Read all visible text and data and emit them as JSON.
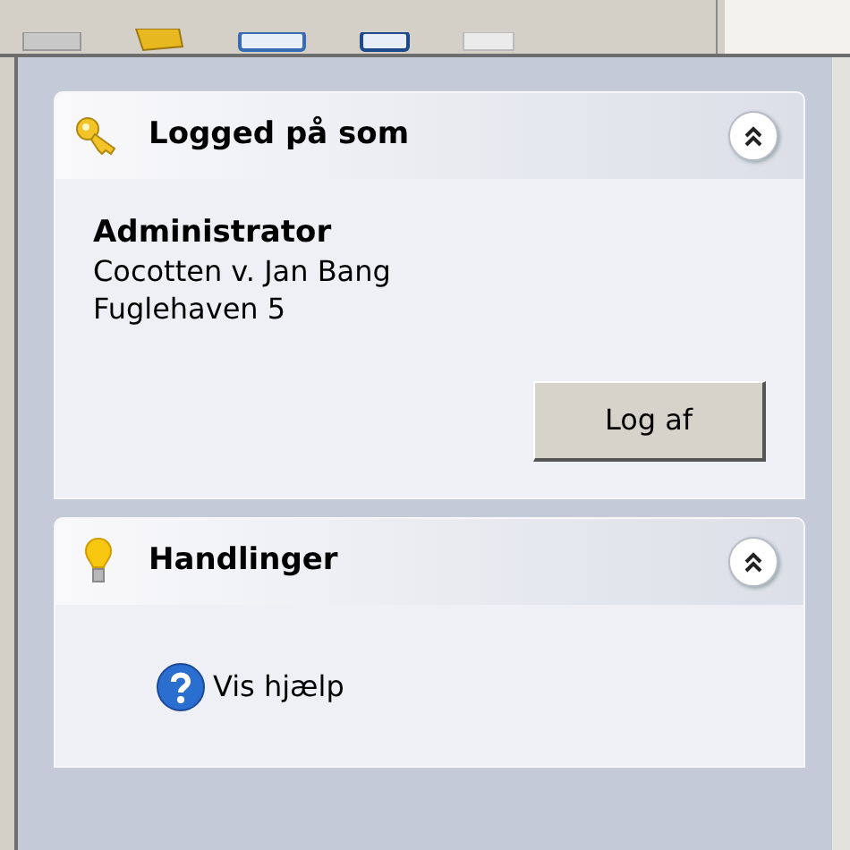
{
  "sections": [
    {
      "kind": "user",
      "title": "Logged på som",
      "expanded": true,
      "user_name": "Administrator",
      "lines": [
        "Cocotten v. Jan Bang",
        "Fuglehaven 5"
      ],
      "button": "Log af"
    },
    {
      "kind": "actions",
      "title": "Handlinger",
      "expanded": true,
      "links": [
        "Vis hjælp"
      ]
    }
  ]
}
